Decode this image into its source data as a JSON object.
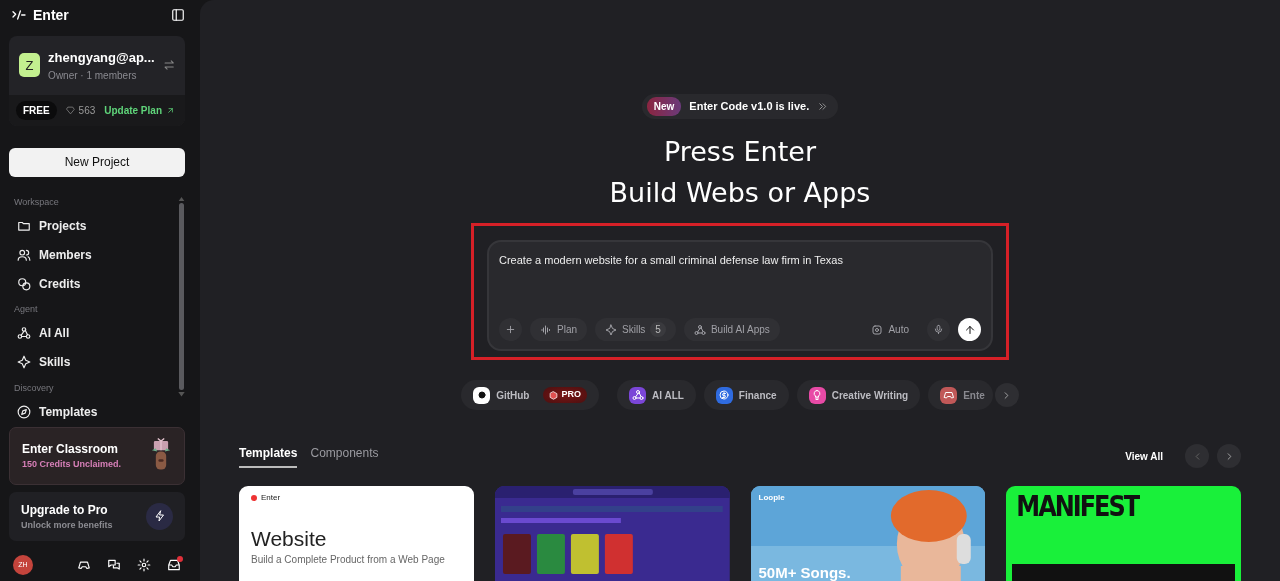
{
  "brand": {
    "name": "Enter"
  },
  "account": {
    "avatar": "Z",
    "email": "zhengyang@ap...",
    "role": "Owner · 1 members",
    "plan": "FREE",
    "credits": "563",
    "upgrade_link": "Update Plan"
  },
  "new_project": "New Project",
  "nav_sections": [
    {
      "heading": "Workspace",
      "items": [
        {
          "kind": "folder",
          "label": "Projects"
        },
        {
          "kind": "members",
          "label": "Members"
        },
        {
          "kind": "coins",
          "label": "Credits"
        }
      ]
    },
    {
      "heading": "Agent",
      "items": [
        {
          "kind": "webhook",
          "label": "AI All"
        },
        {
          "kind": "sparkle",
          "label": "Skills"
        }
      ]
    },
    {
      "heading": "Discovery",
      "items": [
        {
          "kind": "compass",
          "label": "Templates"
        }
      ]
    }
  ],
  "promo_cards": [
    {
      "kind": "classroom",
      "title": "Enter Classroom",
      "subtitle": "150 Credits Unclaimed."
    },
    {
      "kind": "upgrade",
      "title": "Upgrade to Pro",
      "subtitle": "Unlock more benefits"
    }
  ],
  "footer": {
    "avatar": "ZH",
    "inbox_unread": true
  },
  "announcement": {
    "badge": "New",
    "text": "Enter Code v1.0 is live."
  },
  "headline": [
    "Press Enter",
    "Build Webs or Apps"
  ],
  "prompt": {
    "value": "Create a modern website for a small criminal defense law firm in Texas",
    "highlighted": true,
    "tools": [
      {
        "kind": "plan",
        "label": "Plan"
      },
      {
        "kind": "skills",
        "label": "Skills",
        "count": "5"
      },
      {
        "kind": "apps",
        "label": "Build AI Apps"
      }
    ],
    "model": "Auto"
  },
  "chips": [
    {
      "kind": "github",
      "label": "GitHub",
      "badge": "PRO"
    },
    {
      "kind": "ai",
      "label": "AI ALL"
    },
    {
      "kind": "finance",
      "label": "Finance"
    },
    {
      "kind": "writing",
      "label": "Creative Writing"
    },
    {
      "kind": "game",
      "label": "Ente"
    }
  ],
  "gallery": {
    "tabs": [
      {
        "label": "Templates",
        "selected": true
      },
      {
        "label": "Components",
        "selected": false
      }
    ],
    "view_all": "View All",
    "cards": [
      {
        "kind": "website",
        "brand": "Enter",
        "title": "Website",
        "subtitle": "Build a Complete Product from a Web Page"
      },
      {
        "kind": "dashboard"
      },
      {
        "kind": "music",
        "brand": "Loople",
        "title": "50M+ Songs."
      },
      {
        "kind": "manifest",
        "title": "MANIFEST"
      }
    ]
  }
}
